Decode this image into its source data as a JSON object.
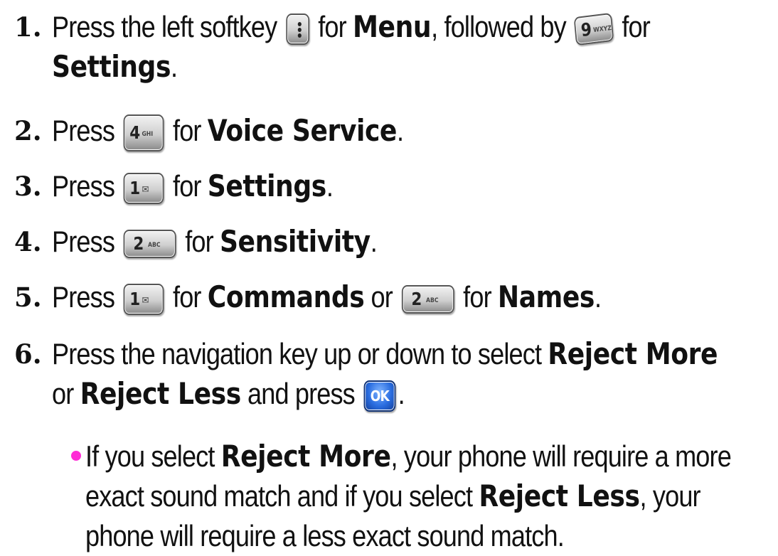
{
  "steps": [
    {
      "number": "1.",
      "line1": {
        "a": "Press the left softkey",
        "b": "for",
        "c": "Menu",
        "d": ", followed by",
        "e": "for"
      },
      "line2": {
        "bold": "Settings",
        "tail": "."
      }
    },
    {
      "number": "2.",
      "pre": "Press",
      "mid": "for",
      "bold": "Voice Service",
      "tail": "."
    },
    {
      "number": "3.",
      "pre": "Press",
      "mid": "for",
      "bold": "Settings",
      "tail": "."
    },
    {
      "number": "4.",
      "pre": "Press",
      "mid": "for",
      "bold": "Sensitivity",
      "tail": "."
    },
    {
      "number": "5.",
      "pre": "Press",
      "mid": "for",
      "bold": "Commands",
      "or": "or",
      "mid2": "for",
      "bold2": "Names",
      "tail": "."
    },
    {
      "number": "6.",
      "line1": {
        "pre": "Press the navigation key up or down to select",
        "bold": "Reject More"
      },
      "line2": {
        "or": "or",
        "bold": "Reject Less",
        "mid": "and press",
        "tail": "."
      }
    }
  ],
  "bullet": {
    "l1_pre": "If you select",
    "l1_bold": "Reject More",
    "l1_post": ", your phone will require a more",
    "l2_pre": "exact sound match and if you select",
    "l2_bold": "Reject Less",
    "l2_post": ", your",
    "l3": "phone will require a less exact sound match."
  },
  "keys": {
    "nine": {
      "digit": "9",
      "letters": "WXYZ"
    },
    "four": {
      "digit": "4",
      "letters": "GHI"
    },
    "one": {
      "digit": "1",
      "letters": "✉"
    },
    "two": {
      "digit": "2",
      "letters": "ABC"
    },
    "ok": {
      "label": "OK"
    }
  },
  "colors": {
    "bullet": "#ff2bd6",
    "ok_key": "#2a6de0",
    "text": "#111111"
  },
  "icons": [
    "left-softkey-icon",
    "key-9-icon",
    "key-4-icon",
    "key-1-icon",
    "key-2-icon",
    "ok-key-icon"
  ]
}
